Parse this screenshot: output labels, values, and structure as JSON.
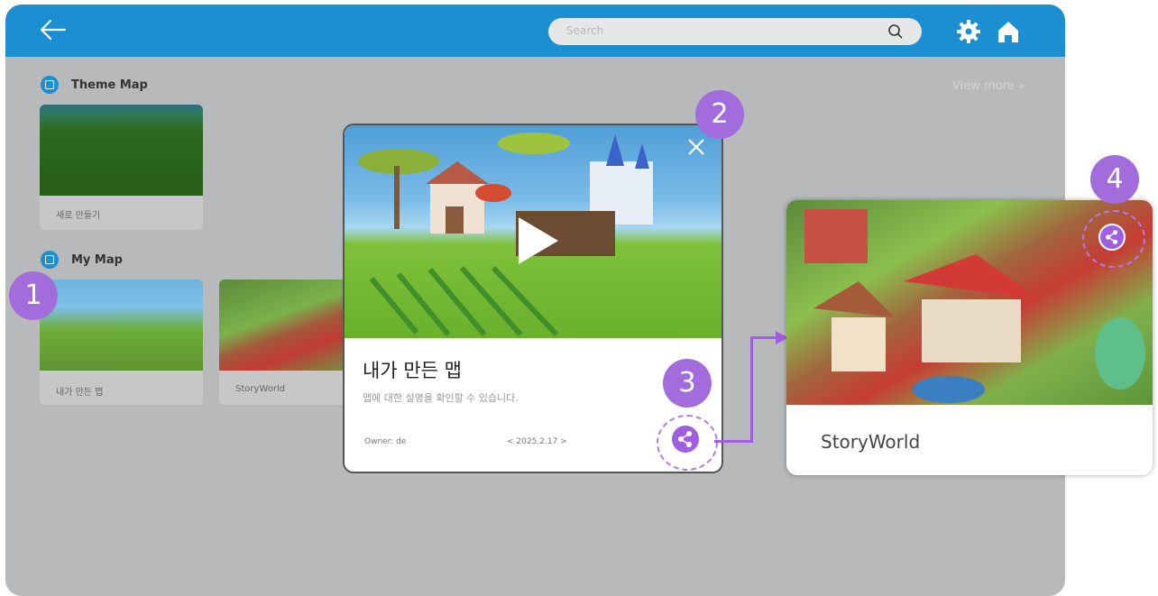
{
  "header": {
    "back_icon": "arrow-left-icon",
    "search": {
      "placeholder": "Search"
    },
    "settings_icon": "gear-icon",
    "home_icon": "home-icon",
    "color": "#1b8fd2"
  },
  "theme_map": {
    "title": "Theme Map",
    "view_more": "View more",
    "cards": [
      {
        "label": "새로 만들기"
      }
    ]
  },
  "my_map": {
    "title": "My Map",
    "cards": [
      {
        "label": "내가 만든 맵"
      },
      {
        "label": "StoryWorld"
      }
    ]
  },
  "modal": {
    "title": "내가 만든 맵",
    "description": "맵에 대한 설명을 확인할 수 있습니다.",
    "owner": "Owner: de",
    "date": "< 2025.2.17 >",
    "close_icon": "close-icon",
    "play_icon": "play-icon",
    "share_icon": "share-icon"
  },
  "callout": {
    "title": "StoryWorld",
    "share_icon": "share-icon"
  },
  "badges": [
    "1",
    "2",
    "3",
    "4"
  ],
  "accent": "#a26cdd"
}
